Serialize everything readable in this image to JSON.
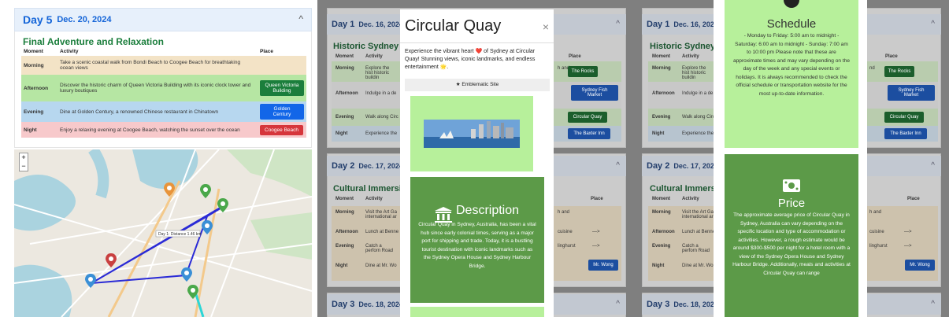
{
  "panel1": {
    "day_title": "Day 5",
    "day_date": "Dec. 20, 2024",
    "chevron": "^",
    "theme": "Final Adventure and Relaxation",
    "headers": [
      "Moment",
      "Activity",
      "Place"
    ],
    "rows": [
      {
        "moment": "Morning",
        "activity": "Take a scenic coastal walk from Bondi Beach to Coogee Beach for breathtaking ocean views",
        "place": ""
      },
      {
        "moment": "Afternoon",
        "activity": "Discover the historic charm of Queen Victoria Building with its iconic clock tower and luxury boutiques",
        "place": "Queen Victoria Building"
      },
      {
        "moment": "Evening",
        "activity": "Dine at Golden Century, a renowned Chinese restaurant in Chinatown",
        "place": "Golden Century"
      },
      {
        "moment": "Night",
        "activity": "Enjoy a relaxing evening at Coogee Beach, watching the sunset over the ocean",
        "place": "Coogee Beach"
      }
    ],
    "map": {
      "zoom_in": "+",
      "zoom_out": "−",
      "route_label": "Day 1: Distance 1.46 km"
    }
  },
  "background": {
    "day1_title": "Day 1",
    "day1_date": "Dec. 16, 2024",
    "day1_theme": "Historic Sydney D",
    "day2_title": "Day 2",
    "day2_date": "Dec. 17, 2024",
    "day2_theme": "Cultural Immersio",
    "day3_title": "Day 3",
    "day3_date": "Dec. 18, 2024",
    "moment": "Moment",
    "activity": "Activity",
    "place": "Place",
    "morning": "Morning",
    "afternoon": "Afternoon",
    "evening": "Evening",
    "night": "Night",
    "d1_morning": "Explore the hist historic buildin",
    "d1_afternoon": "Indulge in a de",
    "d1_evening": "Walk along Circ",
    "d1_night": "Experience the",
    "d2_morning": "Visit the Art Ga international ar",
    "d2_afternoon": "Lunch at Benne",
    "d2_evening": "Catch a perforn Road",
    "d2_night": "Dine at Mr. Wo",
    "t_rocks": "The Rocks",
    "t_fish": "Sydney Fish Market",
    "t_cq": "Circular Quay",
    "t_baxter": "The Baxter Inn",
    "t_wong": "Mr. Wong",
    "arrow": "—>",
    "frag_and": "h and",
    "frag_cuisine": "cuisine",
    "frag_darling": "linghurst",
    "frag_nd": "nd"
  },
  "modal": {
    "title": "Circular Quay",
    "close": "×",
    "intro": "Experience the vibrant heart ❤️ of Sydney at Circular Quay! Stunning views, iconic landmarks, and endless entertainment 🌟.",
    "badge": "Emblematic Site",
    "desc_title": "Description",
    "desc_text": "Circular Quay in Sydney, Australia, has been a vital hub since early colonial times, serving as a major port for shipping and trade. Today, it is a bustling tourist destination with iconic landmarks such as the Sydney Opera House and Sydney Harbour Bridge."
  },
  "modal2": {
    "schedule_title": "Schedule",
    "schedule_text": "- Monday to Friday: 5:00 am to midnight - Saturday: 6:00 am to midnight - Sunday: 7:00 am to 10:00 pm Please note that these are approximate times and may vary depending on the day of the week and any special events or holidays. It is always recommended to check the official schedule or transportation website for the most up-to-date information.",
    "price_title": "Price",
    "price_text": "The approximate average price of Circular Quay in Sydney, Australia can vary depending on the specific location and type of accommodation or activities. However, a rough estimate would be around $300-$500 per night for a hotel room with a view of the Sydney Opera House and Sydney Harbour Bridge. Additionally, meals and activities at Circular Quay can range"
  },
  "icons": [
    "chevron-up-icon",
    "star-icon",
    "bank-icon",
    "money-icon",
    "map-marker-icon"
  ],
  "colors": {
    "accent_blue": "#1266e8",
    "accent_green": "#1b7e3c",
    "accent_red": "#d6353b",
    "light_green": "#b7f09b",
    "dark_green": "#5c9a48"
  }
}
